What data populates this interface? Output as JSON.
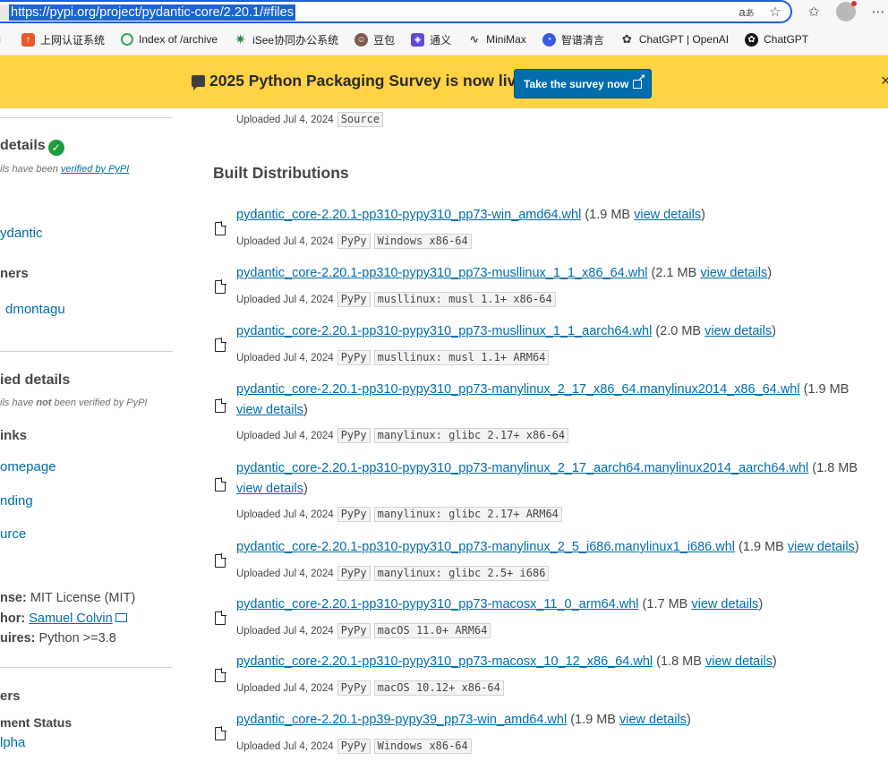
{
  "browser": {
    "url": "https://pypi.org/project/pydantic-core/2.20.1/#files",
    "icons": [
      "read-aloud-icon",
      "favorite-star-icon",
      "collections-icon",
      "profile-avatar",
      "more-menu-icon"
    ]
  },
  "favorites": [
    {
      "label": "上网认证系统",
      "icon": "portal-icon",
      "color": "#e55b2b"
    },
    {
      "label": "Index of /archive",
      "icon": "circle-icon",
      "color": "#3aa655"
    },
    {
      "label": "iSee协同办公系统",
      "icon": "gear-icon",
      "color": "#2d8a3e"
    },
    {
      "label": "豆包",
      "icon": "avatar-icon",
      "color": "#7a5a4a"
    },
    {
      "label": "通义",
      "icon": "tongyi-icon",
      "color": "#5b4bd6"
    },
    {
      "label": "MiniMax",
      "icon": "wave-icon",
      "color": "#444444"
    },
    {
      "label": "智谱清言",
      "icon": "zhipu-icon",
      "color": "#3558e6"
    },
    {
      "label": "ChatGPT | OpenAI",
      "icon": "openai-icon",
      "color": "#333333"
    },
    {
      "label": "ChatGPT",
      "icon": "openai-icon",
      "color": "#111111"
    }
  ],
  "banner": {
    "text": "2025 Python Packaging Survey is now live!",
    "button": "Take the survey now",
    "close": "×"
  },
  "sidebar": {
    "verified_title": "details",
    "verified_note_prefix": "ils have been",
    "verified_note_link": "verified by PyPI",
    "org_link": "ydantic",
    "maintainers_title": "ners",
    "maintainer": "dmontagu",
    "unverified_title": "ied details",
    "unverified_note_prefix": "ils have",
    "unverified_note_bold": "not",
    "unverified_note_suffix": "been verified by PyPI",
    "links_title": "inks",
    "links": [
      "omepage",
      "nding",
      "urce"
    ],
    "license_label": "nse:",
    "license_value": "MIT License (MIT)",
    "author_label": "hor:",
    "author_value": "Samuel Colvin",
    "requires_label": "uires:",
    "requires_value": "Python >=3.8",
    "classifiers_title": "ers",
    "dev_status_title": "ment Status",
    "dev_status_value": "lpha"
  },
  "main": {
    "source_uploaded": "Uploaded Jul 4, 2024",
    "source_tag": "Source",
    "built_title": "Built Distributions",
    "view_details": "view details",
    "distributions": [
      {
        "file": "pydantic_core-2.20.1-pp310-pypy310_pp73-win_amd64.whl",
        "size": "1.9 MB",
        "uploaded": "Uploaded Jul 4, 2024",
        "tags": [
          "PyPy",
          "Windows x86-64"
        ],
        "wrap": false
      },
      {
        "file": "pydantic_core-2.20.1-pp310-pypy310_pp73-musllinux_1_1_x86_64.whl",
        "size": "2.1 MB",
        "uploaded": "Uploaded Jul 4, 2024",
        "tags": [
          "PyPy",
          "musllinux: musl 1.1+ x86-64"
        ],
        "wrap": false
      },
      {
        "file": "pydantic_core-2.20.1-pp310-pypy310_pp73-musllinux_1_1_aarch64.whl",
        "size": "2.0 MB",
        "uploaded": "Uploaded Jul 4, 2024",
        "tags": [
          "PyPy",
          "musllinux: musl 1.1+ ARM64"
        ],
        "wrap": false
      },
      {
        "file": "pydantic_core-2.20.1-pp310-pypy310_pp73-manylinux_2_17_x86_64.manylinux2014_x86_64.whl",
        "size": "1.9 MB",
        "uploaded": "Uploaded Jul 4, 2024",
        "tags": [
          "PyPy",
          "manylinux: glibc 2.17+ x86-64"
        ],
        "wrap": true
      },
      {
        "file": "pydantic_core-2.20.1-pp310-pypy310_pp73-manylinux_2_17_aarch64.manylinux2014_aarch64.whl",
        "size": "1.8 MB",
        "uploaded": "Uploaded Jul 4, 2024",
        "tags": [
          "PyPy",
          "manylinux: glibc 2.17+ ARM64"
        ],
        "wrap": true
      },
      {
        "file": "pydantic_core-2.20.1-pp310-pypy310_pp73-manylinux_2_5_i686.manylinux1_i686.whl",
        "size": "1.9 MB",
        "uploaded": "Uploaded Jul 4, 2024",
        "tags": [
          "PyPy",
          "manylinux: glibc 2.5+ i686"
        ],
        "wrap": false
      },
      {
        "file": "pydantic_core-2.20.1-pp310-pypy310_pp73-macosx_11_0_arm64.whl",
        "size": "1.7 MB",
        "uploaded": "Uploaded Jul 4, 2024",
        "tags": [
          "PyPy",
          "macOS 11.0+ ARM64"
        ],
        "wrap": false
      },
      {
        "file": "pydantic_core-2.20.1-pp310-pypy310_pp73-macosx_10_12_x86_64.whl",
        "size": "1.8 MB",
        "uploaded": "Uploaded Jul 4, 2024",
        "tags": [
          "PyPy",
          "macOS 10.12+ x86-64"
        ],
        "wrap": false
      },
      {
        "file": "pydantic_core-2.20.1-pp39-pypy39_pp73-win_amd64.whl",
        "size": "1.9 MB",
        "uploaded": "Uploaded Jul 4, 2024",
        "tags": [
          "PyPy",
          "Windows x86-64"
        ],
        "wrap": false
      }
    ]
  }
}
